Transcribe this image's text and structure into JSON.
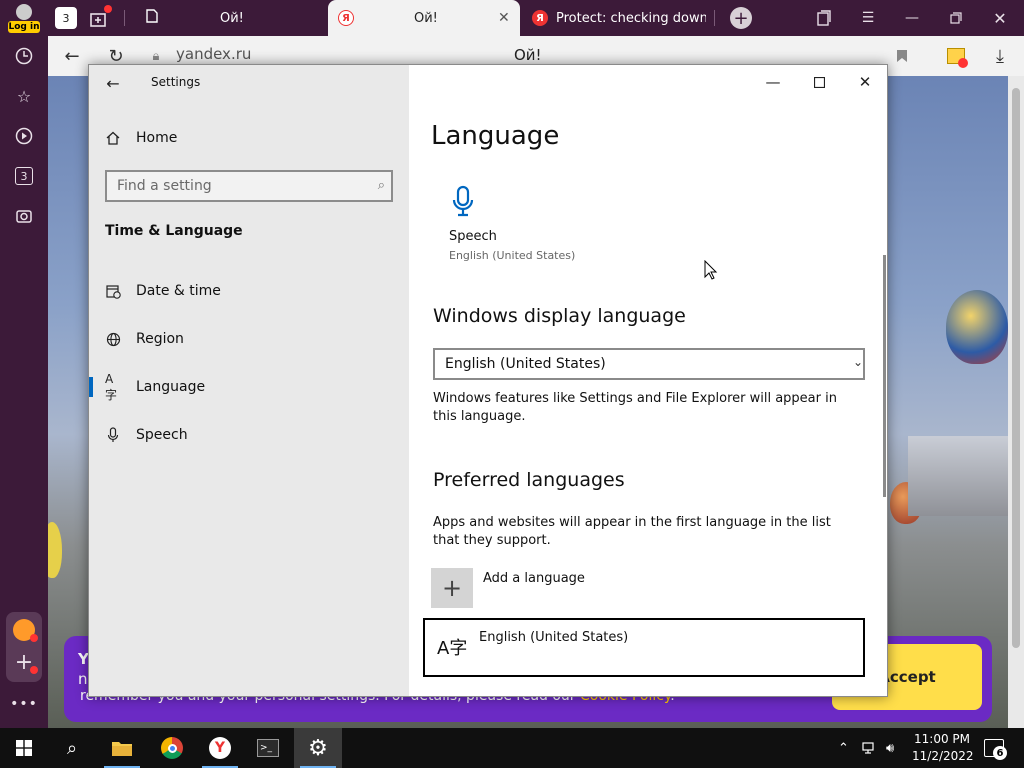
{
  "browser": {
    "profile_label": "Log in",
    "tab_counter": "3",
    "tabs": [
      {
        "title": "Ой!"
      },
      {
        "title": "Ой!"
      },
      {
        "title": "Protect: checking downlo"
      }
    ],
    "url": "yandex.ru",
    "page_title": "Ой!",
    "sidebar_counter": "3"
  },
  "cookie_banner": {
    "line1_start": "Y",
    "line2_start": "n",
    "line3": "remember you and your personal settings. For details, please read our",
    "policy_link": "Cookie Policy",
    "line3_end": ".",
    "accept_label": "Accept"
  },
  "settings": {
    "window_title": "Settings",
    "home_label": "Home",
    "search_placeholder": "Find a setting",
    "group_title": "Time & Language",
    "nav": [
      {
        "label": "Date & time",
        "icon": "calendar-clock-icon"
      },
      {
        "label": "Region",
        "icon": "globe-icon"
      },
      {
        "label": "Language",
        "icon": "language-icon",
        "selected": true
      },
      {
        "label": "Speech",
        "icon": "microphone-icon"
      }
    ],
    "page_heading": "Language",
    "speech_tile": {
      "title": "Speech",
      "subtitle": "English (United States)"
    },
    "display_language": {
      "heading": "Windows display language",
      "selected": "English (United States)",
      "description": "Windows features like Settings and File Explorer will appear in this language."
    },
    "preferred": {
      "heading": "Preferred languages",
      "description": "Apps and websites will appear in the first language in the list that they support.",
      "add_label": "Add a language",
      "languages": [
        {
          "name": "English (United States)"
        }
      ]
    }
  },
  "taskbar": {
    "time": "11:00 PM",
    "date": "11/2/2022",
    "notification_count": "6"
  },
  "colors": {
    "browser_chrome": "#3c1a39",
    "accent": "#0067c0",
    "accept_button": "#ffde4a",
    "cookie_bar": "#6b2ac4"
  }
}
